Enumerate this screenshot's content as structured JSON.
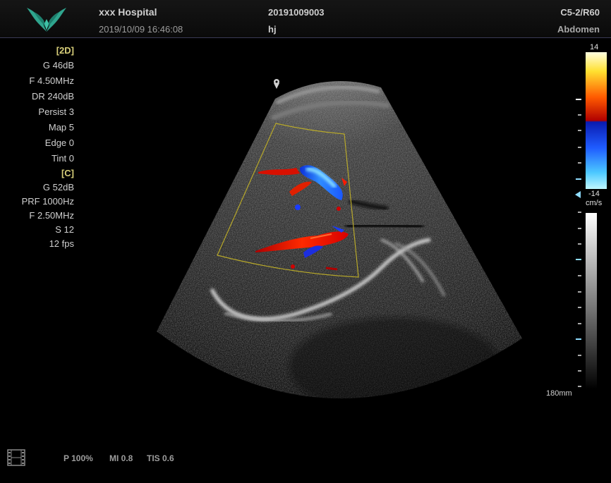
{
  "header": {
    "hospital": "xxx Hospital",
    "datetime": "2019/10/09 16:46:08",
    "patient_id": "20191009003",
    "operator": "hj",
    "probe": "C5-2/R60",
    "exam": "Abdomen"
  },
  "params_2d": {
    "label": "[2D]",
    "gain": "G 46dB",
    "freq": "F 4.50MHz",
    "dr": "DR 240dB",
    "persist": "Persist 3",
    "map": "Map 5",
    "edge": "Edge 0",
    "tint": "Tint 0"
  },
  "params_color": {
    "label": "[C]",
    "gain": "G 52dB",
    "prf": "PRF 1000Hz",
    "freq": "F 2.50MHz",
    "s": "S 12",
    "fps": "12 fps"
  },
  "color_scale": {
    "max": "14",
    "min": "-14",
    "unit": "cm/s"
  },
  "depth": "180mm",
  "footer": {
    "power": "P 100%",
    "mi": "MI 0.8",
    "tis": "TIS 0.6"
  },
  "icons": [
    "logo-icon",
    "focus-marker-icon",
    "baseline-arrow-icon",
    "film-icon"
  ],
  "colors": {
    "logo": "#2fa58e",
    "param_header": "#d8cf7a",
    "roi_box": "#b7a82a"
  }
}
